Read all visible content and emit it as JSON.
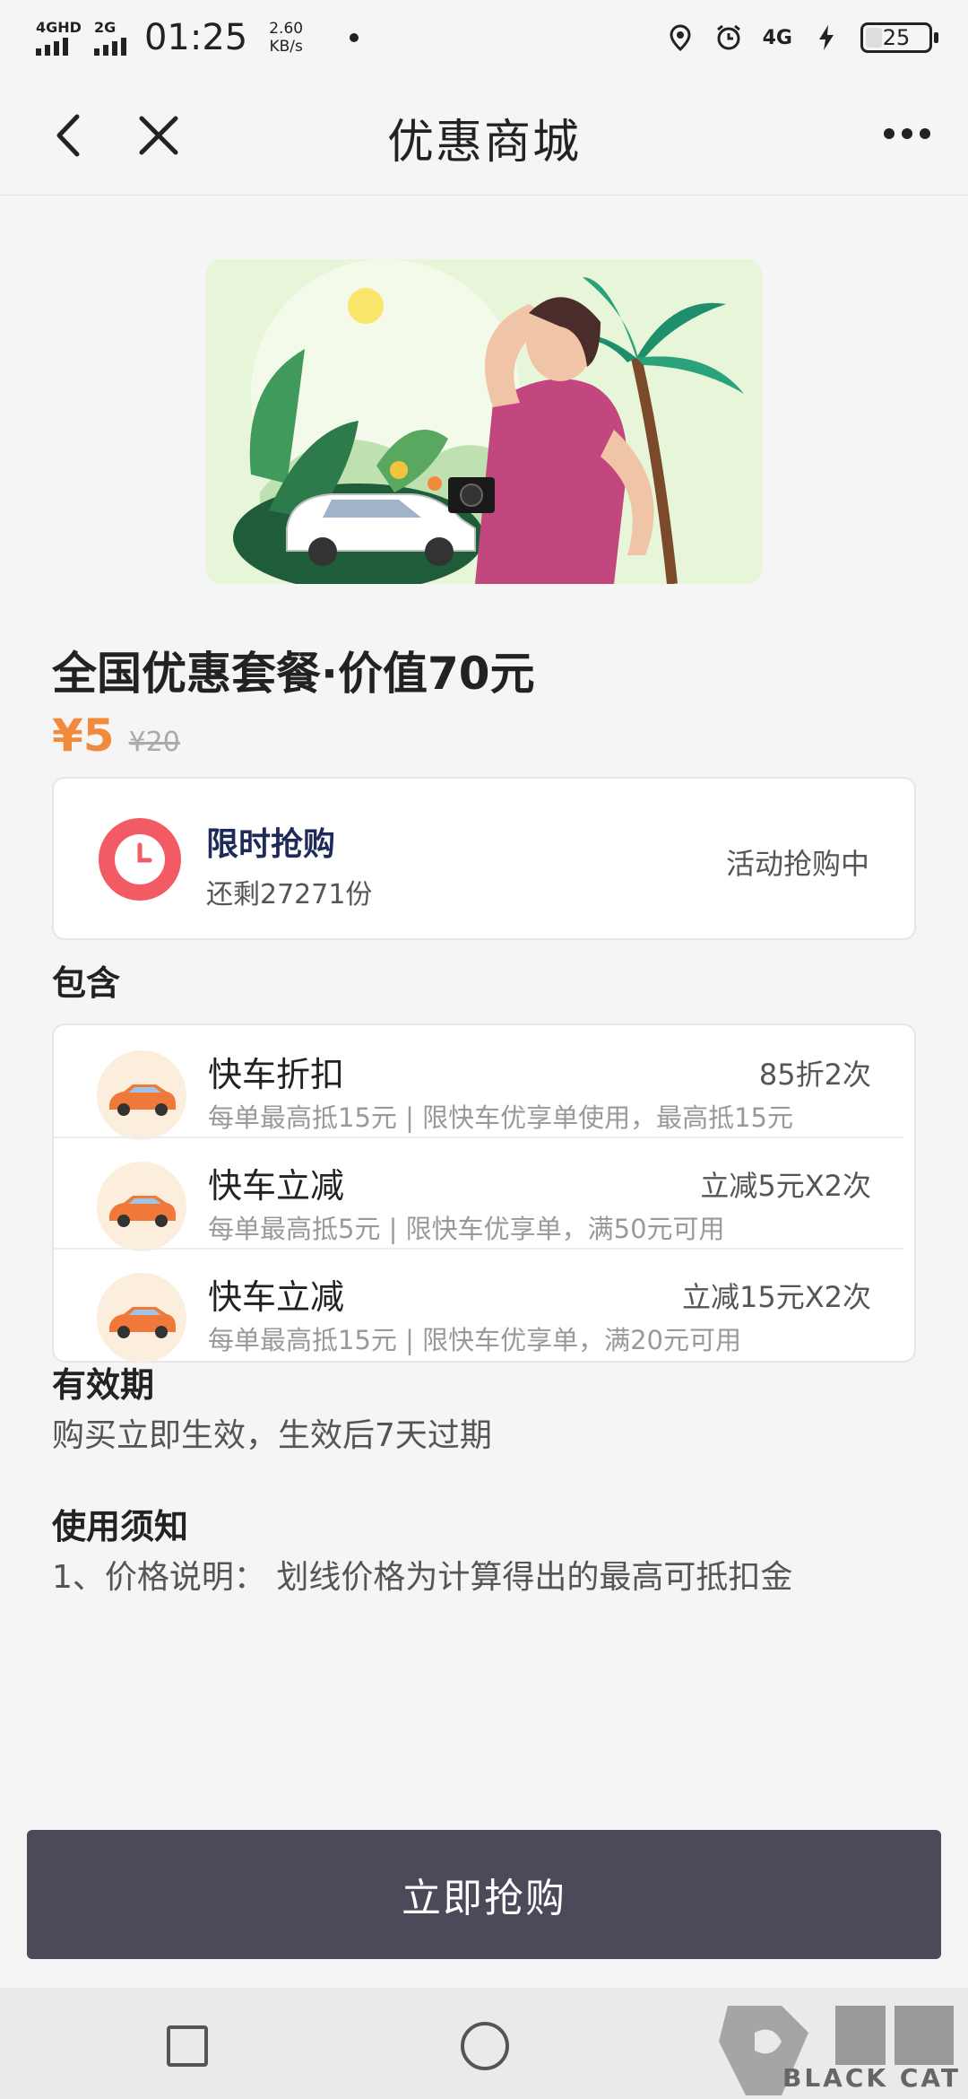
{
  "status_bar": {
    "net1": "4GHD",
    "net2": "2G",
    "time": "01:25",
    "speed_value": "2.60",
    "speed_unit": "KB/s",
    "net3": "4G",
    "battery": "25"
  },
  "title_bar": {
    "title": "优惠商城"
  },
  "product": {
    "title": "全国优惠套餐·价值70元",
    "price_now": "¥5",
    "price_old": "¥20"
  },
  "flash_sale": {
    "title": "限时抢购",
    "remaining": "还剩27271份",
    "status": "活动抢购中"
  },
  "includes": {
    "label": "包含",
    "items": [
      {
        "name": "快车折扣",
        "value": "85折2次",
        "desc": "每单最高抵15元 | 限快车优享单使用，最高抵15元"
      },
      {
        "name": "快车立减",
        "value": "立减5元X2次",
        "desc": "每单最高抵5元 | 限快车优享单，满50元可用"
      },
      {
        "name": "快车立减",
        "value": "立减15元X2次",
        "desc": "每单最高抵15元 | 限快车优享单，满20元可用"
      }
    ]
  },
  "validity": {
    "label": "有效期",
    "text": "购买立即生效，生效后7天过期"
  },
  "notice": {
    "label": "使用须知",
    "text": "1、价格说明： 划线价格为计算得出的最高可抵扣金"
  },
  "action": {
    "buy_label": "立即抢购"
  },
  "watermark": {
    "text": "BLACK CAT"
  },
  "colors": {
    "price": "#f28a3c",
    "button": "#4a4a58",
    "clock": "#f25b63",
    "flash_title": "#1d2a5a"
  }
}
